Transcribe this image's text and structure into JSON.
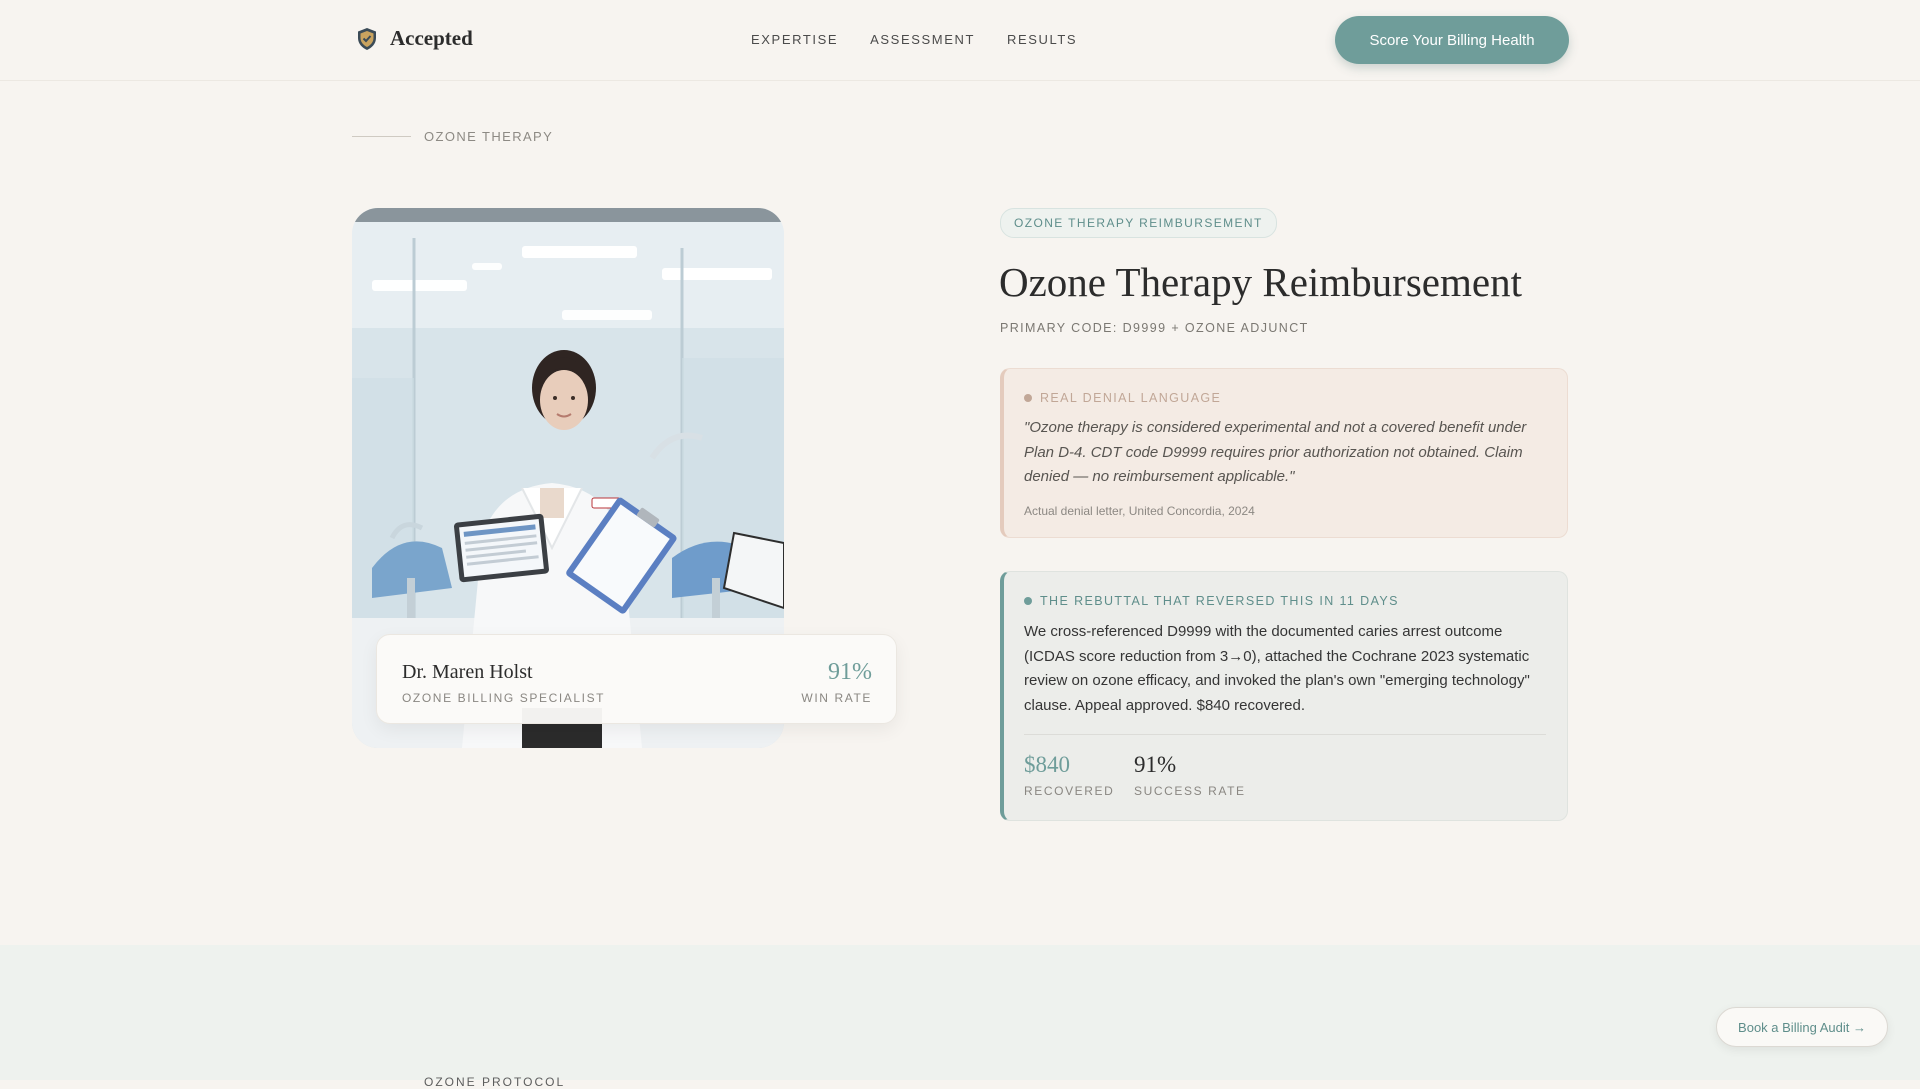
{
  "header": {
    "brand": "Accepted",
    "nav": [
      "EXPERTISE",
      "ASSESSMENT",
      "RESULTS"
    ],
    "cta": "Score Your Billing Health"
  },
  "breadcrumb": "OZONE THERAPY",
  "profile": {
    "name": "Dr. Maren Holst",
    "role": "OZONE BILLING SPECIALIST",
    "win_rate": "91%",
    "win_rate_label": "WIN RATE"
  },
  "main": {
    "tag": "OZONE THERAPY REIMBURSEMENT",
    "title": "Ozone Therapy Reimbursement",
    "code": "PRIMARY CODE: D9999 + OZONE ADJUNCT"
  },
  "denial": {
    "label": "REAL DENIAL LANGUAGE",
    "quote": "\"Ozone therapy is considered experimental and not a covered benefit under Plan D-4. CDT code D9999 requires prior authorization not obtained. Claim denied — no reimbursement applicable.\"",
    "source": "Actual denial letter, United Concordia, 2024"
  },
  "rebuttal": {
    "label": "THE REBUTTAL THAT REVERSED THIS IN 11 DAYS",
    "text": "We cross-referenced D9999 with the documented caries arrest outcome (ICDAS score reduction from 3→0), attached the Cochrane 2023 systematic review on ozone efficacy, and invoked the plan's own \"emerging technology\" clause. Appeal approved. $840 recovered.",
    "stats": [
      {
        "value": "$840",
        "label": "RECOVERED"
      },
      {
        "value": "91%",
        "label": "SUCCESS RATE"
      }
    ]
  },
  "lower": {
    "peek": "OZONE PROTOCOL"
  },
  "float_cta": "Book a Billing Audit →",
  "colors": {
    "accent": "#6f9d9a",
    "background": "#f7f4f0",
    "denial_bg": "#f4ebe4",
    "rebuttal_bg": "#ecedea"
  }
}
